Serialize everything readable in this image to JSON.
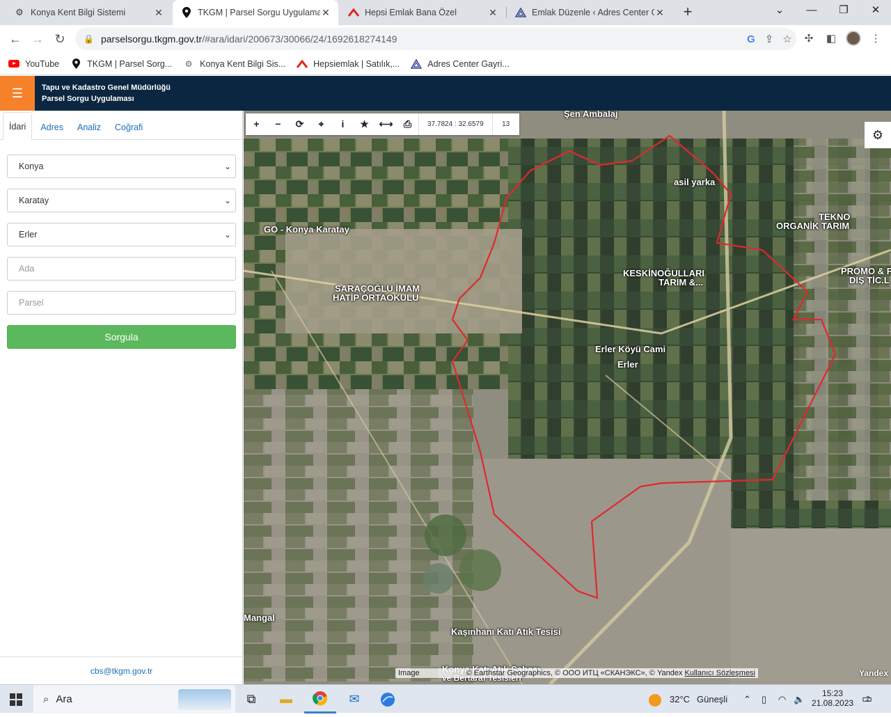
{
  "browser": {
    "tabs": [
      {
        "title": "Konya Kent Bilgi Sistemi",
        "icon": "gear-logo-icon",
        "active": false
      },
      {
        "title": "TKGM | Parsel Sorgu Uygulaması",
        "icon": "map-pin-icon",
        "active": true
      },
      {
        "title": "Hepsi Emlak Bana Özel",
        "icon": "hepsiemlak-icon",
        "active": false
      },
      {
        "title": "Emlak Düzenle ‹ Adres Center Ga",
        "icon": "adres-center-icon",
        "active": false
      }
    ],
    "url_host": "parselsorgu.tkgm.gov.tr",
    "url_path": "/#ara/idari/200673/30066/24/1692618274149",
    "bookmarks": [
      {
        "label": "YouTube",
        "icon": "youtube-icon"
      },
      {
        "label": "TKGM | Parsel Sorg...",
        "icon": "map-pin-icon"
      },
      {
        "label": "Konya Kent Bilgi Sis...",
        "icon": "gear-logo-icon"
      },
      {
        "label": "Hepsiemlak | Satılık,...",
        "icon": "hepsiemlak-icon"
      },
      {
        "label": "Adres Center Gayri...",
        "icon": "adres-center-icon"
      }
    ]
  },
  "app": {
    "title_line1": "Tapu ve Kadastro Genel Müdürlüğü",
    "title_line2": "Parsel Sorgu Uygulaması",
    "accent": "#f5822a",
    "header_bg": "#0b2640"
  },
  "sidebar": {
    "tabs": [
      "İdari",
      "Adres",
      "Analiz",
      "Coğrafi"
    ],
    "active_tab": "İdari",
    "province": "Konya",
    "district": "Karatay",
    "neighborhood": "Erler",
    "ada_placeholder": "Ada",
    "parsel_placeholder": "Parsel",
    "submit_label": "Sorgula",
    "footer_email": "cbs@tkgm.gov.tr"
  },
  "map": {
    "coordinates": "37.7824 : 32.6579",
    "zoom": "13",
    "labels": [
      {
        "text": "Şen Ambalaj"
      },
      {
        "text": "asil yarka"
      },
      {
        "text": "TEKNO"
      },
      {
        "text": "ORGANİK TARIM"
      },
      {
        "text": "GO - Konya Karatay"
      },
      {
        "text": "SARAÇOĞLU İMAM"
      },
      {
        "text": "HATİP ORTAOKULU"
      },
      {
        "text": "KESKİNOĞULLARI"
      },
      {
        "text": "TARIM &..."
      },
      {
        "text": "PROMO & F"
      },
      {
        "text": "DIŞ TİC.L"
      },
      {
        "text": "Erler Köyü Cami"
      },
      {
        "text": "Erler"
      },
      {
        "text": "Mangal"
      },
      {
        "text": "Kaşınhanı Katı Atık Tesisi"
      },
      {
        "text": "Konya Katı Atık Sahası"
      },
      {
        "text": "ve Bertaraf Tesisleri"
      }
    ],
    "attribution_prefix": "Image",
    "attribution_text": "© Earthstar Geographics, © ООО ИТЦ «СКАНЭКС», © Yandex",
    "attribution_link": "Kullanıcı Sözleşmesi",
    "provider_logo": "Yandex",
    "boundary_color": "#e0282e"
  },
  "taskbar": {
    "search_placeholder": "Ara",
    "temperature": "32°C",
    "weather": "Güneşli",
    "time": "15:23",
    "date": "21.08.2023",
    "notification_count": "2"
  }
}
